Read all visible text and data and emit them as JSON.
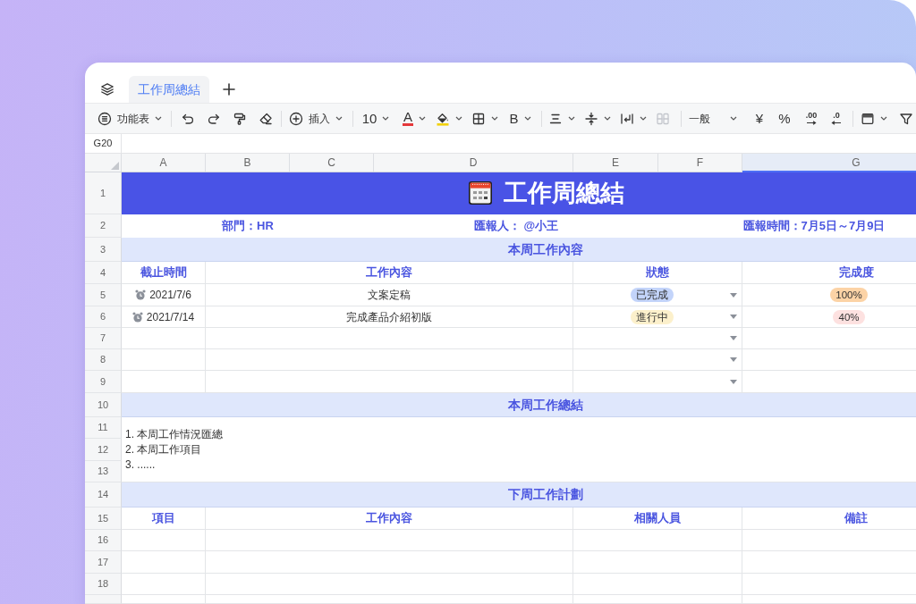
{
  "sheet_tabs": [
    {
      "label": "工作周總結",
      "selected": true
    }
  ],
  "toolbar": {
    "menu_label": "功能表",
    "insert_label": "插入",
    "font_size": "10",
    "font_color_glyph": "A",
    "bold_glyph": "B",
    "merge_button": {
      "disabled": true
    },
    "number_format": "一般",
    "currency_glyph": "¥",
    "percent_glyph": "%",
    "decimal_more_glyph": ".00",
    "decimal_less_glyph": ".0"
  },
  "name_box": "G20",
  "column_headers": [
    {
      "label": "A",
      "selected": false
    },
    {
      "label": "B",
      "selected": false
    },
    {
      "label": "C",
      "selected": false
    },
    {
      "label": "D",
      "selected": false
    },
    {
      "label": "E",
      "selected": false
    },
    {
      "label": "F",
      "selected": false
    },
    {
      "label": "G",
      "selected": true
    }
  ],
  "row_headers": [
    "1",
    "2",
    "3",
    "4",
    "5",
    "6",
    "7",
    "8",
    "9",
    "10",
    "11",
    "12",
    "13",
    "14",
    "15",
    "16",
    "17",
    "18"
  ],
  "title": "工作周總結",
  "info": [
    "部門：HR",
    "匯報人： @小王",
    "匯報時間：7月5日～7月9日"
  ],
  "this_week": {
    "heading": "本周工作內容",
    "columns": [
      "截止時間",
      "工作內容",
      "狀態",
      "完成度"
    ],
    "rows": [
      {
        "kind": "task",
        "deadline": "2021/7/6",
        "content": "文案定稿",
        "status": {
          "label": "已完成",
          "color": "#c3d4fa"
        },
        "progress": {
          "label": "100%",
          "color": "#fcd3a6"
        }
      },
      {
        "kind": "task",
        "deadline": "2021/7/14",
        "content": "完成產品介紹初版",
        "status": {
          "label": "進行中",
          "color": "#fcf0cb"
        },
        "progress": {
          "label": "40%",
          "color": "#fde1e0"
        }
      },
      {
        "kind": "blank"
      },
      {
        "kind": "blank"
      },
      {
        "kind": "blank"
      }
    ]
  },
  "summary": {
    "heading": "本周工作總結",
    "lines": [
      "1. 本周工作情況匯總",
      "2. 本周工作項目",
      "3. ......"
    ]
  },
  "next_week": {
    "heading": "下周工作計劃",
    "columns": [
      "項目",
      "工作內容",
      "相關人員",
      "備註"
    ],
    "rows": [
      {
        "kind": "blank"
      },
      {
        "kind": "blank"
      },
      {
        "kind": "blank"
      }
    ]
  }
}
